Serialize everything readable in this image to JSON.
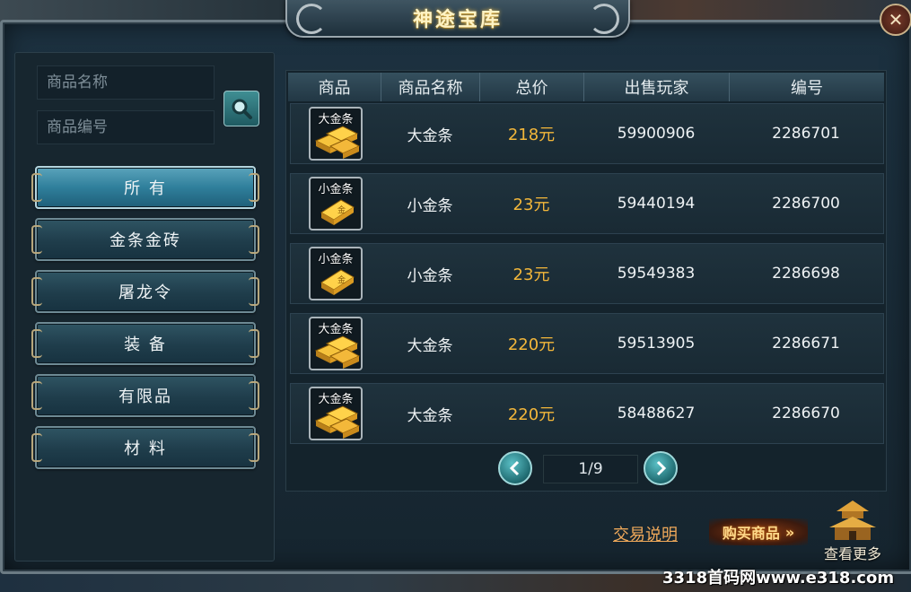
{
  "window": {
    "title": "神途宝库",
    "close_glyph": "✕"
  },
  "search": {
    "name_placeholder": "商品名称",
    "id_placeholder": "商品编号"
  },
  "categories": [
    {
      "label": "所 有",
      "active": true
    },
    {
      "label": "金条金砖",
      "active": false
    },
    {
      "label": "屠龙令",
      "active": false
    },
    {
      "label": "装 备",
      "active": false
    },
    {
      "label": "有限品",
      "active": false
    },
    {
      "label": "材 料",
      "active": false
    }
  ],
  "table": {
    "headers": [
      "商品",
      "商品名称",
      "总价",
      "出售玩家",
      "编号"
    ],
    "rows": [
      {
        "icon_label": "大金条",
        "icon": "gold-bars-large",
        "name": "大金条",
        "price": "218元",
        "seller": "59900906",
        "id": "2286701"
      },
      {
        "icon_label": "小金条",
        "icon": "gold-bar-small",
        "name": "小金条",
        "price": "23元",
        "seller": "59440194",
        "id": "2286700"
      },
      {
        "icon_label": "小金条",
        "icon": "gold-bar-small",
        "name": "小金条",
        "price": "23元",
        "seller": "59549383",
        "id": "2286698"
      },
      {
        "icon_label": "大金条",
        "icon": "gold-bars-large",
        "name": "大金条",
        "price": "220元",
        "seller": "59513905",
        "id": "2286671"
      },
      {
        "icon_label": "大金条",
        "icon": "gold-bars-large",
        "name": "大金条",
        "price": "220元",
        "seller": "58488627",
        "id": "2286670"
      }
    ]
  },
  "pager": {
    "text": "1/9"
  },
  "footer": {
    "help_link": "交易说明",
    "buy_button": "购买商品",
    "buy_arrows": "»",
    "more_label": "查看更多"
  },
  "watermark": "3318首码网www.e318.com",
  "colors": {
    "price": "#f3b73a",
    "link": "#f0a95a",
    "active_tab": "#2f7f9b"
  }
}
